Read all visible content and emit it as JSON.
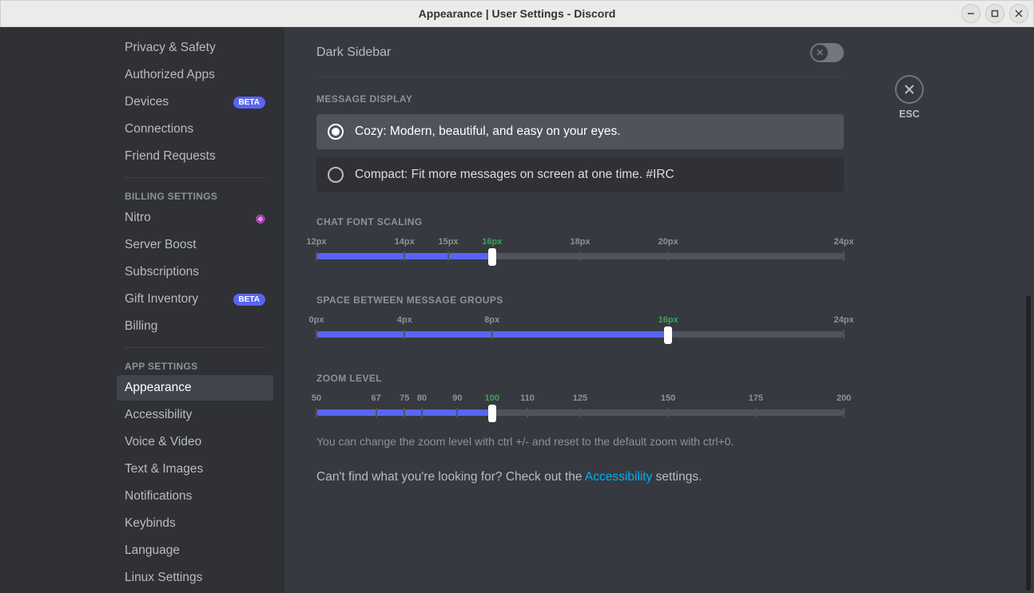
{
  "window": {
    "title": "Appearance | User Settings - Discord"
  },
  "sidebar": {
    "items_top": [
      {
        "label": "Privacy & Safety"
      },
      {
        "label": "Authorized Apps"
      },
      {
        "label": "Devices",
        "badge": "BETA"
      },
      {
        "label": "Connections"
      },
      {
        "label": "Friend Requests"
      }
    ],
    "billing_header": "BILLING SETTINGS",
    "items_billing": [
      {
        "label": "Nitro",
        "nitro": true
      },
      {
        "label": "Server Boost"
      },
      {
        "label": "Subscriptions"
      },
      {
        "label": "Gift Inventory",
        "badge": "BETA"
      },
      {
        "label": "Billing"
      }
    ],
    "app_header": "APP SETTINGS",
    "items_app": [
      {
        "label": "Appearance",
        "selected": true
      },
      {
        "label": "Accessibility"
      },
      {
        "label": "Voice & Video"
      },
      {
        "label": "Text & Images"
      },
      {
        "label": "Notifications"
      },
      {
        "label": "Keybinds"
      },
      {
        "label": "Language"
      },
      {
        "label": "Linux Settings"
      }
    ]
  },
  "esc_label": "ESC",
  "dark_sidebar": {
    "label": "Dark Sidebar",
    "enabled": false
  },
  "message_display": {
    "header": "MESSAGE DISPLAY",
    "cozy": "Cozy: Modern, beautiful, and easy on your eyes.",
    "compact": "Compact: Fit more messages on screen at one time. #IRC",
    "selected": "cozy"
  },
  "sliders": {
    "chat_font": {
      "header": "CHAT FONT SCALING",
      "ticks": [
        {
          "label": "12px",
          "pos": 0
        },
        {
          "label": "14px",
          "pos": 16.7
        },
        {
          "label": "15px",
          "pos": 25
        },
        {
          "label": "16px",
          "pos": 33.3,
          "current": true
        },
        {
          "label": "18px",
          "pos": 50
        },
        {
          "label": "20px",
          "pos": 66.7
        },
        {
          "label": "24px",
          "pos": 100
        }
      ],
      "fill": 33.3
    },
    "space": {
      "header": "SPACE BETWEEN MESSAGE GROUPS",
      "ticks": [
        {
          "label": "0px",
          "pos": 0
        },
        {
          "label": "4px",
          "pos": 16.7
        },
        {
          "label": "8px",
          "pos": 33.3
        },
        {
          "label": "16px",
          "pos": 66.7,
          "current": true
        },
        {
          "label": "24px",
          "pos": 100
        }
      ],
      "fill": 66.7
    },
    "zoom": {
      "header": "ZOOM LEVEL",
      "ticks": [
        {
          "label": "50",
          "pos": 0
        },
        {
          "label": "67",
          "pos": 11.3
        },
        {
          "label": "75",
          "pos": 16.7
        },
        {
          "label": "80",
          "pos": 20
        },
        {
          "label": "90",
          "pos": 26.7
        },
        {
          "label": "100",
          "pos": 33.3,
          "current": true
        },
        {
          "label": "110",
          "pos": 40
        },
        {
          "label": "125",
          "pos": 50
        },
        {
          "label": "150",
          "pos": 66.7
        },
        {
          "label": "175",
          "pos": 83.3
        },
        {
          "label": "200",
          "pos": 100
        }
      ],
      "fill": 33.3,
      "hint": "You can change the zoom level with ctrl +/- and reset to the default zoom with ctrl+0."
    }
  },
  "footer": {
    "pre": "Can't find what you're looking for? Check out the ",
    "link": "Accessibility",
    "post": " settings."
  }
}
